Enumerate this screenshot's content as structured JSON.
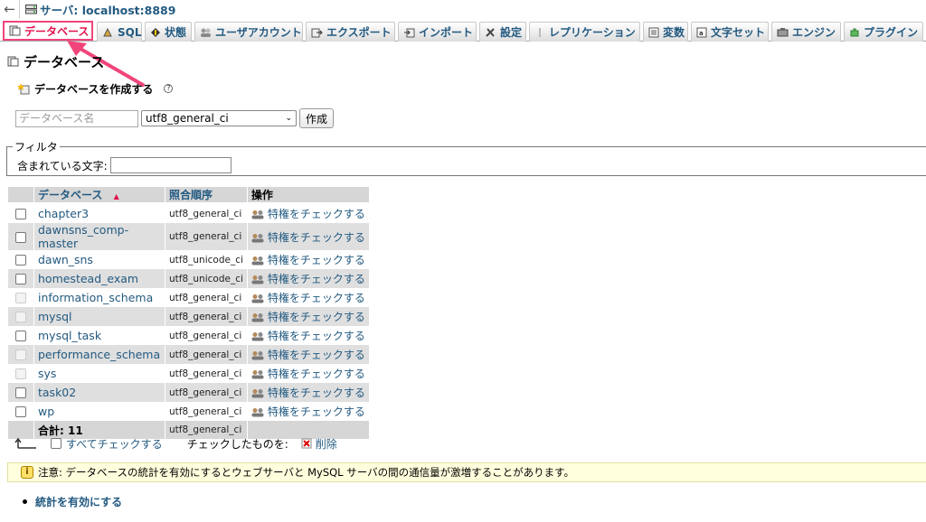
{
  "breadcrumb": {
    "server_label": "サーバ: localhost:8889"
  },
  "tabs": [
    {
      "label": "データベース"
    },
    {
      "label": "SQL"
    },
    {
      "label": "状態"
    },
    {
      "label": "ユーザアカウント"
    },
    {
      "label": "エクスポート"
    },
    {
      "label": "インポート"
    },
    {
      "label": "設定"
    },
    {
      "label": "レプリケーション"
    },
    {
      "label": "変数"
    },
    {
      "label": "文字セット"
    },
    {
      "label": "エンジン"
    },
    {
      "label": "プラグイン"
    }
  ],
  "page": {
    "title": "データベース",
    "create_heading": "データベースを作成する",
    "create": {
      "name_placeholder": "データベース名",
      "collation_value": "utf8_general_ci",
      "create_button": "作成"
    }
  },
  "filter": {
    "legend": "フィルタ",
    "contains_label": "含まれている文字:"
  },
  "table": {
    "headers": {
      "database": "データベース",
      "collation": "照合順序",
      "action": "操作"
    },
    "rows": [
      {
        "name": "chapter3",
        "collation": "utf8_general_ci",
        "action": "特権をチェックする"
      },
      {
        "name": "dawnsns_comp-master",
        "collation": "utf8_general_ci",
        "action": "特権をチェックする"
      },
      {
        "name": "dawn_sns",
        "collation": "utf8_unicode_ci",
        "action": "特権をチェックする"
      },
      {
        "name": "homestead_exam",
        "collation": "utf8_unicode_ci",
        "action": "特権をチェックする"
      },
      {
        "name": "information_schema",
        "collation": "utf8_general_ci",
        "action": "特権をチェックする"
      },
      {
        "name": "mysql",
        "collation": "utf8_general_ci",
        "action": "特権をチェックする"
      },
      {
        "name": "mysql_task",
        "collation": "utf8_general_ci",
        "action": "特権をチェックする"
      },
      {
        "name": "performance_schema",
        "collation": "utf8_general_ci",
        "action": "特権をチェックする"
      },
      {
        "name": "sys",
        "collation": "utf8_general_ci",
        "action": "特権をチェックする"
      },
      {
        "name": "task02",
        "collation": "utf8_general_ci",
        "action": "特権をチェックする"
      },
      {
        "name": "wp",
        "collation": "utf8_general_ci",
        "action": "特権をチェックする"
      }
    ],
    "total_label": "合計: 11",
    "total_collation": "utf8_general_ci"
  },
  "bulk": {
    "check_all": "すべてチェックする",
    "with_selected": "チェックしたものを:",
    "delete": "削除"
  },
  "notice": {
    "text": "注意: データベースの統計を有効にするとウェブサーバと MySQL サーバの間の通信量が激増することがあります。"
  },
  "enable_stats_link": "統計を有効にする",
  "colors": {
    "link": "#235a81",
    "active_tab": "#e2124c",
    "annotation": "#f0457a",
    "notice_bg": "#ffffdd"
  },
  "icons": [
    "back-arrow-icon",
    "server-icon",
    "database-icon",
    "sql-icon",
    "status-icon",
    "users-icon",
    "export-icon",
    "import-icon",
    "settings-icon",
    "replication-icon",
    "variables-icon",
    "charset-icon",
    "engine-icon",
    "plugin-icon",
    "new-db-icon",
    "help-icon",
    "privileges-icon",
    "delete-icon",
    "info-icon"
  ]
}
